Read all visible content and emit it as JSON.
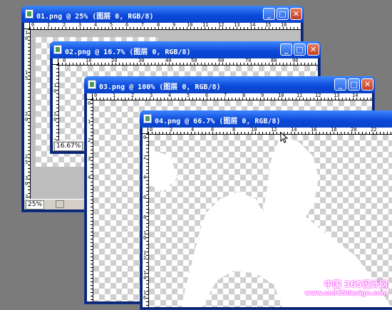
{
  "windows": [
    {
      "title": "01.png @ 25% (图层 0, RGB/8)",
      "zoom": "25%",
      "ruler_top": [
        "0",
        "1",
        "2",
        "3",
        "4",
        "5",
        "6",
        "7",
        "8",
        "9",
        "10",
        "11",
        "12",
        "13",
        "14",
        "15",
        "16"
      ],
      "ruler_left": [
        "1",
        "0",
        "1",
        "5",
        "2",
        "0",
        "2",
        "5",
        "3",
        "0",
        "3",
        "5"
      ]
    },
    {
      "title": "02.png @ 16.7% (图层 0, RGB/8)",
      "zoom": "16.67%",
      "ruler_top": [
        "0",
        "10",
        "20",
        "30",
        "40",
        "50",
        "60",
        "70",
        "80",
        "90"
      ],
      "ruler_left": [
        "1",
        "0",
        "2",
        "0",
        "3",
        "0"
      ]
    },
    {
      "title": "03.png @ 100% (图层 0, RGB/8)",
      "ruler_top": [
        "0",
        "1",
        "2",
        "3",
        "4",
        "5",
        "6",
        "7",
        "8",
        "9",
        "10",
        "11",
        "12",
        "13",
        "14"
      ],
      "ruler_left": [
        "0",
        "1",
        "2",
        "3",
        "4"
      ]
    },
    {
      "title": "04.png @ 66.7% (图层 0, RGB/8)",
      "ruler_top": [
        "0",
        "2",
        "4",
        "6",
        "8",
        "10",
        "12",
        "14",
        "16",
        "18",
        "20",
        "22"
      ],
      "ruler_left": [
        "0",
        "2",
        "4",
        "6",
        "8",
        "1",
        "0",
        "1",
        "2",
        "1",
        "4",
        "1",
        "6"
      ]
    }
  ],
  "controls": {
    "minimize": "_",
    "maximize": "□",
    "close": "✕"
  },
  "watermark": {
    "line1": "中国 365设计网",
    "line2": "www.cn365design.com"
  }
}
